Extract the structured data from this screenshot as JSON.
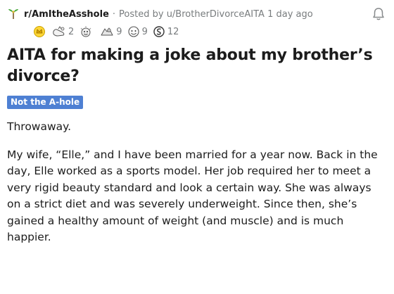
{
  "post": {
    "subreddit": "r/AmItheAsshole",
    "separator": "·",
    "posted_by": "Posted by u/BrotherDivorceAITA 1 day ago",
    "awards": [
      {
        "icon": "gold-award-icon",
        "count": ""
      },
      {
        "icon": "wholesome-award-icon",
        "count": "2"
      },
      {
        "icon": "silver-award-icon",
        "count": ""
      },
      {
        "icon": "helpful-award-icon",
        "count": "9"
      },
      {
        "icon": "wholesome-seal-icon",
        "count": "9"
      },
      {
        "icon": "coin-award-icon",
        "count": "12"
      }
    ],
    "title": "AITA for making a joke about my brother’s divorce?",
    "flair": "Not the A-hole",
    "body": [
      "Throwaway.",
      "My wife, “Elle,” and I have been married for a year now. Back in the day, Elle worked as a sports model. Her job required her to meet a very rigid beauty standard and look a certain way. She was always on a strict diet and was severely underweight. Since then, she’s gained a healthy amount of weight (and muscle) and is much happier."
    ]
  },
  "colors": {
    "flair_bg": "#4e80d3",
    "meta_gray": "#787c7e",
    "text": "#1c1c1c"
  }
}
